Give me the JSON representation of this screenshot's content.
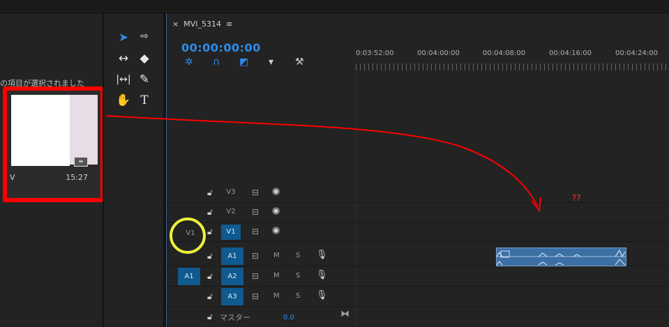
{
  "project_panel": {
    "selection_message": "の項目が選択されました",
    "clip_name": "V",
    "clip_duration": "15:27"
  },
  "timeline": {
    "tab_close": "×",
    "sequence_name": "MVI_5314",
    "tab_menu": "≡",
    "timecode": "00:00:00:00",
    "ruler_labels": [
      "0:03:52:00",
      "00:04:00:00",
      "00:04:08:00",
      "00:04:16:00",
      "00:04:24:00"
    ],
    "video_tracks": [
      {
        "source": "",
        "name": "V3",
        "targeted": false
      },
      {
        "source": "",
        "name": "V2",
        "targeted": false
      },
      {
        "source": "V1",
        "name": "V1",
        "targeted": true
      }
    ],
    "audio_tracks": [
      {
        "source": "",
        "name": "A1",
        "targeted": true
      },
      {
        "source": "A1",
        "name": "A2",
        "targeted": true
      },
      {
        "source": "",
        "name": "A3",
        "targeted": true
      }
    ],
    "mute_label": "M",
    "solo_label": "S",
    "master_label": "マスター",
    "master_value": "0.0",
    "annotation": "??"
  },
  "colors": {
    "accent": "#2d8ceb",
    "annotation_red": "#ff0000",
    "highlight_yellow": "#eef03a",
    "track_target": "#0f5a8f"
  }
}
